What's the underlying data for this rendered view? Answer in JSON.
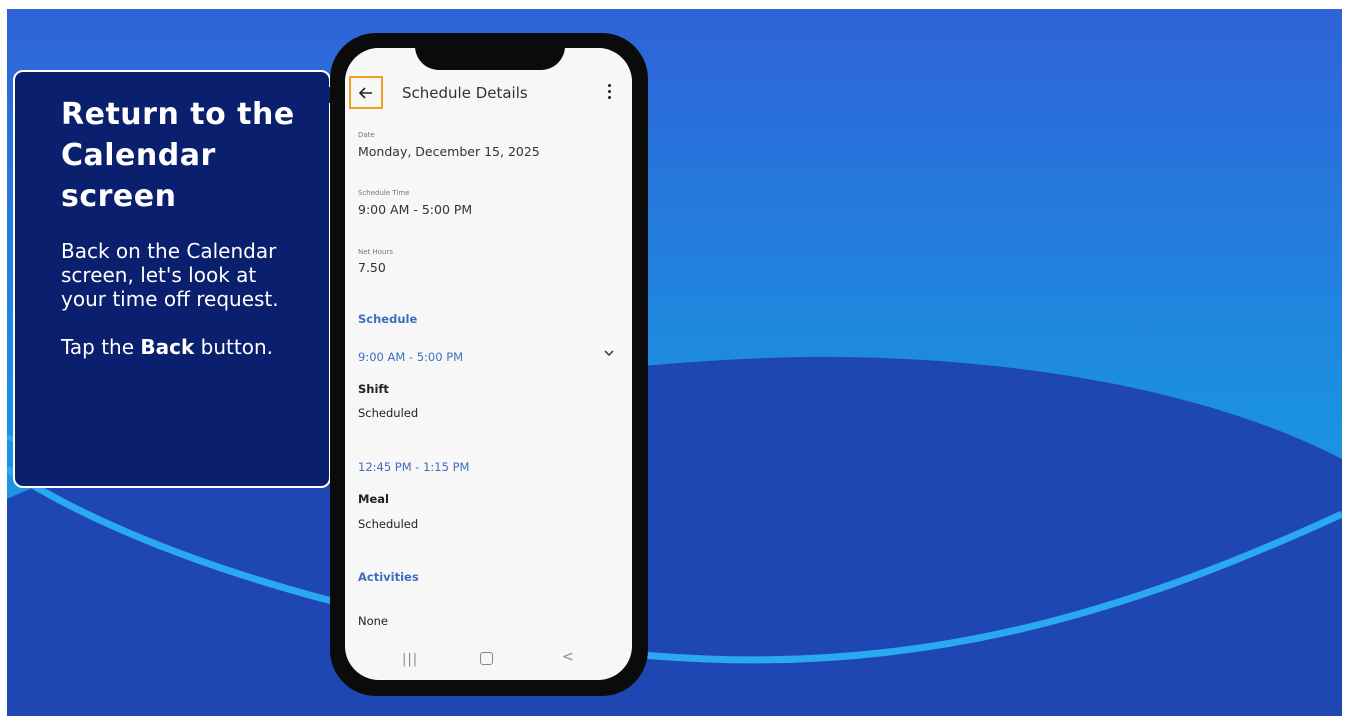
{
  "callout": {
    "title": "Return to the Calendar screen",
    "paragraph1": "Back on the Calendar screen, let's look at your time off request.",
    "paragraph2_prefix": "Tap the ",
    "paragraph2_bold": "Back",
    "paragraph2_suffix": " button."
  },
  "app": {
    "title": "Schedule Details",
    "fields": [
      {
        "label": "Date",
        "value": "Monday, December 15, 2025"
      },
      {
        "label": "Schedule Time",
        "value": "9:00 AM - 5:00 PM"
      },
      {
        "label": "Net Hours",
        "value": "7.50"
      }
    ],
    "schedule_heading": "Schedule",
    "segments": [
      {
        "time": "9:00 AM - 5:00 PM",
        "type": "Shift",
        "status": "Scheduled"
      },
      {
        "time": "12:45 PM - 1:15 PM",
        "type": "Meal",
        "status": "Scheduled"
      }
    ],
    "activities_heading": "Activities",
    "activities_value": "None"
  },
  "nav": {
    "recent": "|||",
    "back": "<"
  },
  "colors": {
    "callout_bg": "#0a1f6e",
    "highlight": "#f0a020",
    "link": "#3c6fbf"
  }
}
